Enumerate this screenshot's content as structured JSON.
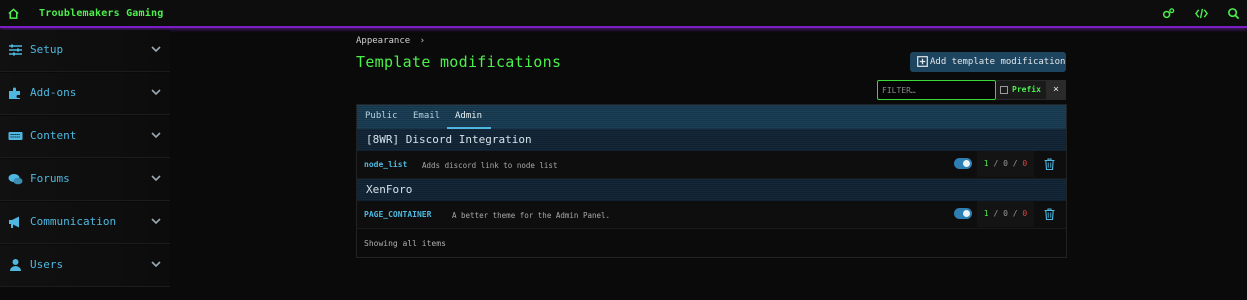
{
  "app": {
    "brand": "Troublemakers Gaming"
  },
  "sidebar": {
    "items": [
      {
        "label": "Setup",
        "icon": "sliders-icon"
      },
      {
        "label": "Add-ons",
        "icon": "puzzle-icon"
      },
      {
        "label": "Content",
        "icon": "keyboard-icon"
      },
      {
        "label": "Forums",
        "icon": "comments-icon"
      },
      {
        "label": "Communication",
        "icon": "bullhorn-icon"
      },
      {
        "label": "Users",
        "icon": "user-icon"
      }
    ]
  },
  "breadcrumb": {
    "label": "Appearance",
    "separator": "›"
  },
  "page": {
    "title": "Template modifications"
  },
  "toolbar": {
    "add_label": "Add template modification"
  },
  "filter": {
    "placeholder": "FILTER…",
    "prefix_label": "Prefix",
    "clear": "×"
  },
  "tabs": [
    {
      "label": "Public"
    },
    {
      "label": "Email"
    },
    {
      "label": "Admin",
      "active": true
    }
  ],
  "groups": [
    {
      "title": "[8WR] Discord Integration",
      "items": [
        {
          "key": "node_list",
          "description": "Adds discord link to node list",
          "enabled": true,
          "ok": "1",
          "warn": "0",
          "fail": "0"
        }
      ]
    },
    {
      "title": "XenForo",
      "items": [
        {
          "key": "PAGE_CONTAINER",
          "description": "A better theme for the Admin Panel.",
          "enabled": true,
          "ok": "1",
          "warn": "0",
          "fail": "0"
        }
      ]
    }
  ],
  "footer": {
    "status": "Showing all items"
  },
  "colors": {
    "accent_green": "#4cf04c",
    "accent_blue": "#4fb8e0",
    "topbar_glow": "#7a1fc4"
  }
}
